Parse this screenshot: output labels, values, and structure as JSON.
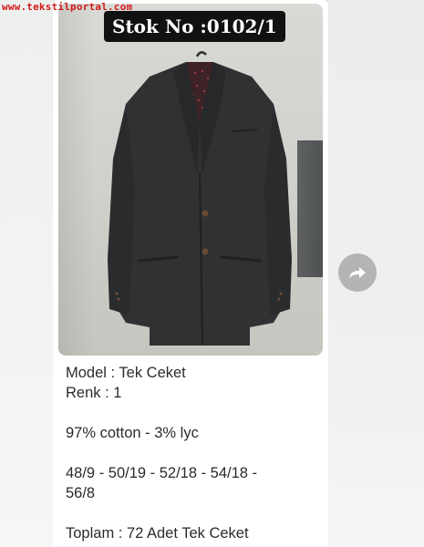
{
  "watermark": "www.tekstilportal.com",
  "photo": {
    "stock_label": "Stok No :0102/1"
  },
  "caption": {
    "lines": [
      "Model : Tek Ceket",
      "Renk : 1",
      "",
      "97% cotton - 3% lyc",
      "",
      "48/9 - 50/19 - 52/18 - 54/18 -",
      "56/8",
      "",
      "Toplam : 72 Adet Tek Ceket"
    ]
  },
  "icons": {
    "forward": "forward-arrow-icon"
  },
  "colors": {
    "bubble": "#ffffff",
    "background": "#e4e6e4",
    "forward_button": "#b3b5b3",
    "watermark": "#d11a1a",
    "label_bg": "#111111"
  }
}
